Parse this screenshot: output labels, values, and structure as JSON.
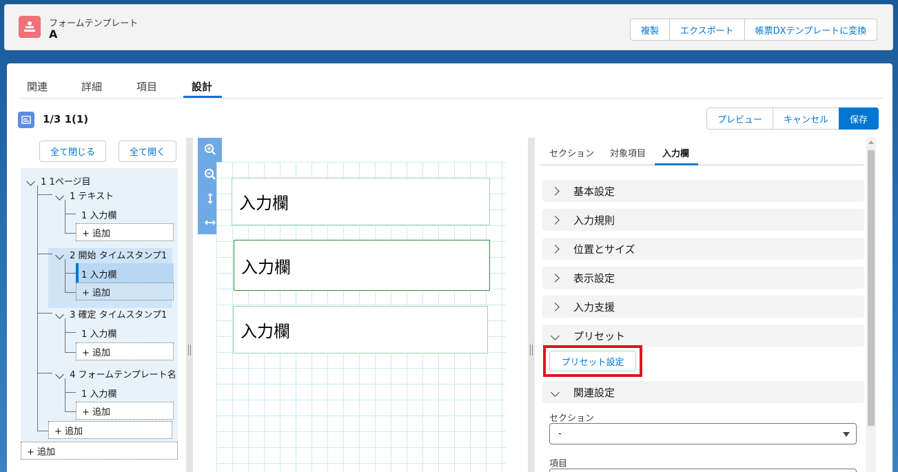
{
  "header": {
    "subtitle": "フォームテンプレート",
    "title": "A",
    "buttons": {
      "copy": "複製",
      "export": "エクスポート",
      "convert": "帳票DXテンプレートに変換"
    }
  },
  "tabs": {
    "related": "関連",
    "detail": "詳細",
    "fields": "項目",
    "design": "設計"
  },
  "record": {
    "title": "1/3 1(1)",
    "buttons": {
      "preview": "プレビュー",
      "cancel": "キャンセル",
      "save": "保存"
    }
  },
  "tree": {
    "collapse_all": "全て閉じる",
    "expand_all": "全て開く",
    "page": "1 1ページ目",
    "groups": [
      {
        "label": "1 テキスト",
        "child": "1 入力欄",
        "add": "+ 追加"
      },
      {
        "label": "2 開始 タイムスタンプ1",
        "child": "1 入力欄",
        "add": "+ 追加"
      },
      {
        "label": "3 確定 タイムスタンプ1",
        "child": "1 入力欄",
        "add": "+ 追加"
      },
      {
        "label": "4 フォームテンプレート名",
        "child": "1 入力欄",
        "add": "+ 追加"
      }
    ],
    "page_add": "+ 追加",
    "root_add": "+ 追加"
  },
  "canvas": {
    "fields": [
      "入力欄",
      "入力欄",
      "入力欄"
    ]
  },
  "right": {
    "tabs": {
      "section": "セクション",
      "target": "対象項目",
      "input": "入力欄"
    },
    "sections": [
      "基本設定",
      "入力規則",
      "位置とサイズ",
      "表示設定",
      "入力支援",
      "プリセット",
      "関連設定"
    ],
    "preset_button": "プリセット設定",
    "section_label": "セクション",
    "section_value": "-",
    "item_label": "項目"
  }
}
